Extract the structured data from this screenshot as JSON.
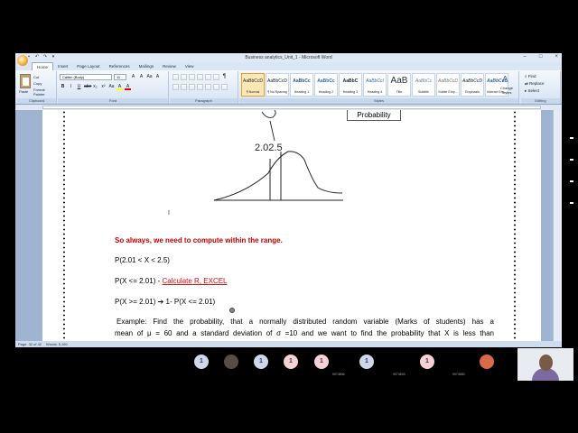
{
  "window": {
    "title": "Business analytics_Unit_1 - Microsoft Word",
    "controls": [
      "–",
      "□",
      "×"
    ],
    "qat_icons": [
      "save-icon",
      "undo-icon",
      "redo-icon",
      "dropdown-icon"
    ]
  },
  "ribbon": {
    "tabs": [
      "Home",
      "Insert",
      "Page Layout",
      "References",
      "Mailings",
      "Review",
      "View"
    ],
    "active_tab": "Home",
    "clipboard": {
      "paste": "Paste",
      "cut": "Cut",
      "copy": "Copy",
      "format_painter": "Format Painter",
      "label": "Clipboard"
    },
    "font": {
      "name": "Calibri (Body)",
      "size": "11",
      "row1": [
        "A",
        "A",
        "Aa",
        "A"
      ],
      "row2": [
        "B",
        "I",
        "U",
        "abe",
        "x₂",
        "x²",
        "Aa",
        "A",
        "A"
      ],
      "label": "Font"
    },
    "paragraph": {
      "label": "Paragraph",
      "pilcrow": "¶"
    },
    "styles": {
      "tiles": [
        {
          "sample": "AaBbCcDd",
          "name": "¶ Normal",
          "selected": true
        },
        {
          "sample": "AaBbCcDd",
          "name": "¶ No Spacing",
          "selected": false
        },
        {
          "sample": "AaBbCc",
          "name": "Heading 1",
          "selected": false
        },
        {
          "sample": "AaBbCc",
          "name": "Heading 2",
          "selected": false
        },
        {
          "sample": "AaBbC",
          "name": "Heading 3",
          "selected": false
        },
        {
          "sample": "AaBbCcI",
          "name": "Heading 4",
          "selected": false
        },
        {
          "sample": "AaB",
          "name": "Title",
          "selected": false
        },
        {
          "sample": "AaBbCc",
          "name": "Subtitle",
          "selected": false
        },
        {
          "sample": "AaBbCcDd",
          "name": "Subtle Emp...",
          "selected": false
        },
        {
          "sample": "AaBbCcDd",
          "name": "Emphasis",
          "selected": false
        },
        {
          "sample": "AaBbCcDc",
          "name": "Intense Em...",
          "selected": false
        }
      ],
      "change_styles": "Change Styles",
      "label": "Styles"
    },
    "editing": {
      "find": "Find",
      "replace": "Replace",
      "select": "Select",
      "label": "Editing"
    }
  },
  "document": {
    "probability_box": "Probability",
    "curve_annotation": "2.02.5",
    "range_note": "So always, we need to compute within the range.",
    "line1": "P(2.01 < X < 2.5)",
    "line2_prefix": "P(X <= 2.01)  - ",
    "line2_link": "Calculate  R, EXCEL",
    "line3_prefix": "P(X >= 2.01)  ",
    "line3_arrow": "➔",
    "line3_suffix": " 1- P(X <= 2.01)",
    "example_line1": "Example: Find the probability, that a normally distributed random variable (Marks of students) has a",
    "example_line2": "mean of μ = 60 and a standard deviation of σ =10 and we want to find the probability that X is less than"
  },
  "statusbar": {
    "page": "Page: 32 of 42",
    "words": "Words: 5,160"
  },
  "meeting": {
    "participants": [
      {
        "initial": "1",
        "color": "#cfd8ea",
        "label": ""
      },
      {
        "initial": "",
        "color": "#5a4a48",
        "label": ""
      },
      {
        "initial": "1",
        "color": "#cfd8ea",
        "label": ""
      },
      {
        "initial": "1",
        "color": "#f6d2d6",
        "label": ""
      },
      {
        "initial": "1",
        "color": "#f6d2d6",
        "label": ""
      },
      {
        "initial": "1",
        "color": "#cfd8ea",
        "label": "9074806"
      },
      {
        "initial": "1",
        "color": "#f6d2d6",
        "label": "9074693"
      },
      {
        "initial": "",
        "color": "#d86a4a",
        "label": "9074683"
      }
    ]
  }
}
